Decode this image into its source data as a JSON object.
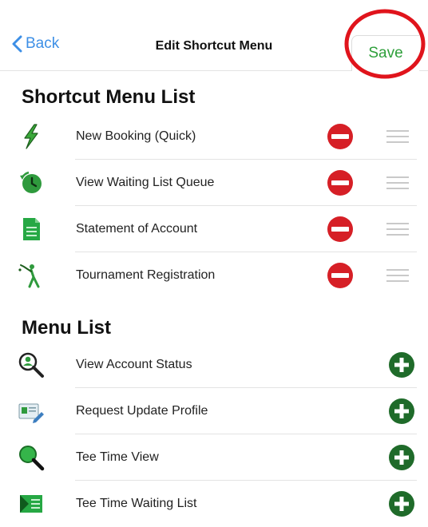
{
  "navbar": {
    "back_label": "Back",
    "title": "Edit Shortcut Menu",
    "save_label": "Save"
  },
  "shortcut_section": {
    "title": "Shortcut Menu List",
    "items": [
      {
        "label": "New Booking (Quick)",
        "icon": "lightning-bolt-icon"
      },
      {
        "label": "View Waiting List Queue",
        "icon": "clock-icon"
      },
      {
        "label": "Statement of Account",
        "icon": "document-icon"
      },
      {
        "label": "Tournament Registration",
        "icon": "golfer-icon"
      }
    ]
  },
  "menu_section": {
    "title": "Menu List",
    "items": [
      {
        "label": "View Account Status",
        "icon": "account-search-icon"
      },
      {
        "label": "Request Update Profile",
        "icon": "profile-card-icon"
      },
      {
        "label": "Tee Time View",
        "icon": "magnifier-icon"
      },
      {
        "label": "Tee Time Waiting List",
        "icon": "waiting-list-icon"
      }
    ]
  },
  "colors": {
    "accent_blue": "#3d8fe6",
    "save_green": "#2e9f3a",
    "remove_red": "#d61f26",
    "add_green": "#1f6b2a",
    "annotation_red": "#e0141c"
  }
}
